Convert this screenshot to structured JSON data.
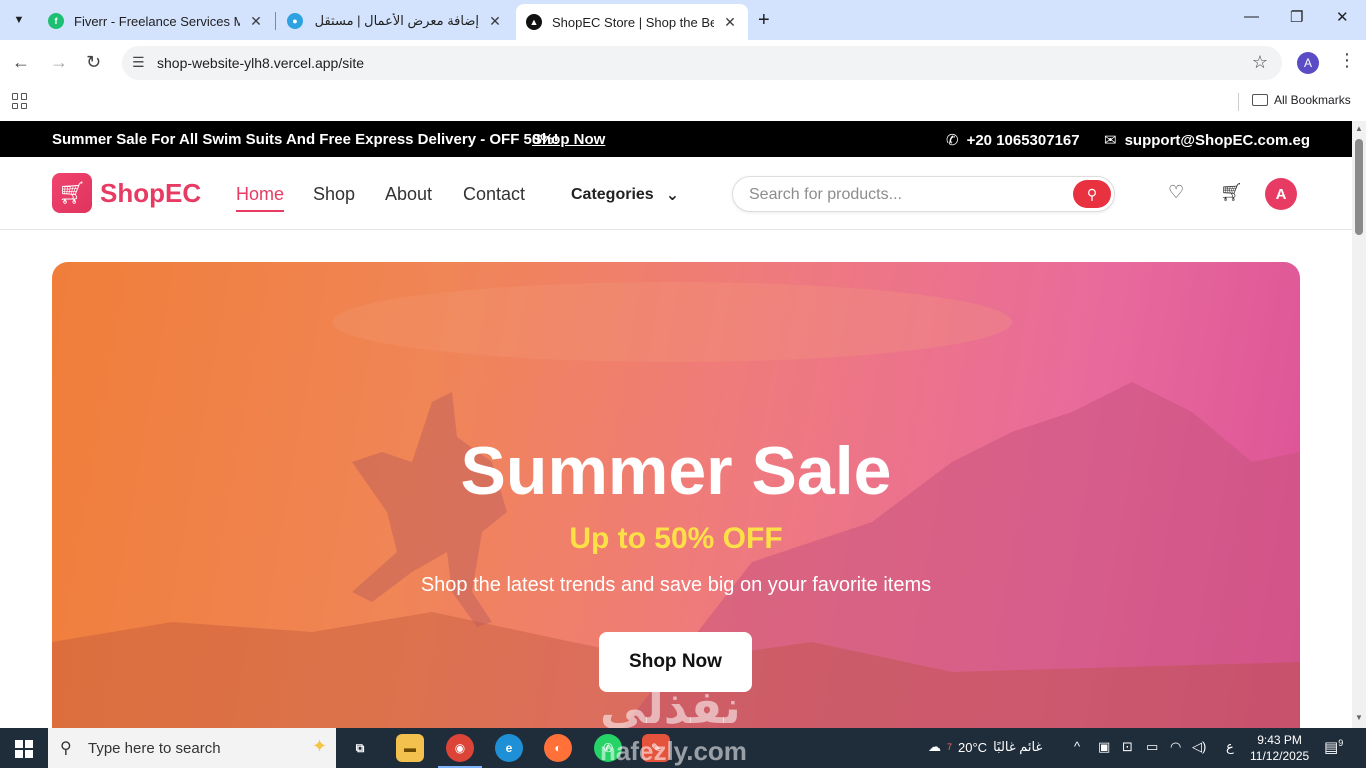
{
  "browser": {
    "tabs": [
      {
        "title": "Fiverr - Freelance Services Mark",
        "favicon_color": "#1dbf73",
        "active": false
      },
      {
        "title": "إضافة معرض الأعمال | مستقل",
        "favicon_color": "#2ea1e0",
        "active": false
      },
      {
        "title": "ShopEC Store | Shop the Best D",
        "favicon_color": "#111111",
        "active": true
      }
    ],
    "url": "shop-website-ylh8.vercel.app/site",
    "profile_initial": "A",
    "bookmarks_label": "All Bookmarks"
  },
  "site": {
    "topbar": {
      "promo": "Summer Sale For All Swim Suits And Free Express Delivery - OFF 50%!",
      "promo_link": "Shop Now",
      "phone": "+20 1065307167",
      "email": "support@ShopEC.com.eg"
    },
    "brand": "ShopEC",
    "nav": [
      {
        "label": "Home",
        "active": true
      },
      {
        "label": "Shop",
        "active": false
      },
      {
        "label": "About",
        "active": false
      },
      {
        "label": "Contact",
        "active": false
      }
    ],
    "categories_label": "Categories",
    "search_placeholder": "Search for products...",
    "avatar_initial": "A",
    "hero": {
      "title": "Summer Sale",
      "subtitle": "Up to 50% OFF",
      "description": "Shop the latest trends and save big on your favorite items",
      "cta": "Shop Now"
    },
    "accent_color": "#e73b63"
  },
  "watermark": {
    "arabic": "نفذلي",
    "latin": "nafezly.com"
  },
  "taskbar": {
    "search_placeholder": "Type here to search",
    "weather_temp": "20°C",
    "weather_text": "غائم غالبًا",
    "weather_badge": "7",
    "lang": "ع",
    "time": "9:43 PM",
    "date": "11/12/2025",
    "notifications": "9"
  }
}
